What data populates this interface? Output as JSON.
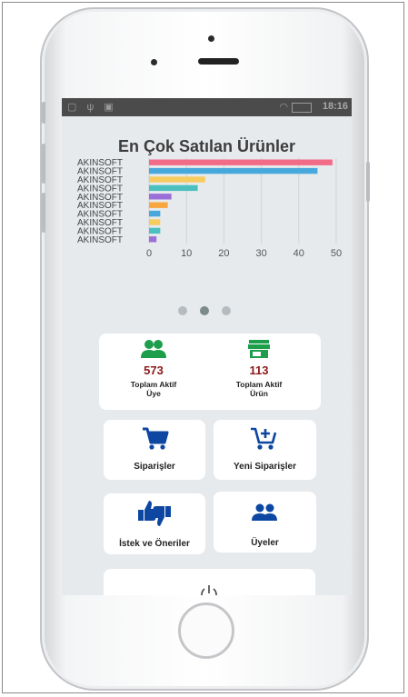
{
  "status_bar": {
    "time": "18:16"
  },
  "chart_data": {
    "type": "bar",
    "orientation": "horizontal",
    "title": "En Çok Satılan Ürünler",
    "categories": [
      "AKINSOFT",
      "AKINSOFT",
      "AKINSOFT",
      "AKINSOFT",
      "AKINSOFT",
      "AKINSOFT",
      "AKINSOFT",
      "AKINSOFT",
      "AKINSOFT",
      "AKINSOFT"
    ],
    "values": [
      49,
      45,
      15,
      13,
      6,
      5,
      3,
      3,
      3,
      2
    ],
    "bar_colors": [
      "#f26b87",
      "#48a8dc",
      "#f7cb5e",
      "#4cc0bf",
      "#9b6fd8",
      "#f7a640",
      "#48a8dc",
      "#f7cb5e",
      "#4cc0bf",
      "#9b6fd8"
    ],
    "x_ticks": [
      "0",
      "10",
      "20",
      "30",
      "40",
      "50"
    ],
    "xlim": [
      0,
      50
    ],
    "grid": true
  },
  "pager": {
    "count": 3,
    "active": 1
  },
  "stats": {
    "members": {
      "value": "573",
      "label_line1": "Toplam Aktif",
      "label_line2": "Üye",
      "icon": "group-icon",
      "color": "#1e9e4a"
    },
    "products": {
      "value": "113",
      "label_line1": "Toplam Aktif",
      "label_line2": "Ürün",
      "icon": "store-icon",
      "color": "#1e9e4a"
    }
  },
  "menu": {
    "orders": {
      "label": "Siparişler",
      "icon": "cart-icon"
    },
    "new_orders": {
      "label": "Yeni Siparişler",
      "icon": "cart-add-icon"
    },
    "suggestions": {
      "label": "İstek ve Öneriler",
      "icon": "thumbs-icon"
    },
    "members": {
      "label": "Üyeler",
      "icon": "group-icon"
    },
    "logout": {
      "icon": "power-icon"
    }
  },
  "colors": {
    "primary_icon": "#0d47a1",
    "stat_green": "#1e9e4a",
    "stat_number": "#8b1a1a"
  }
}
